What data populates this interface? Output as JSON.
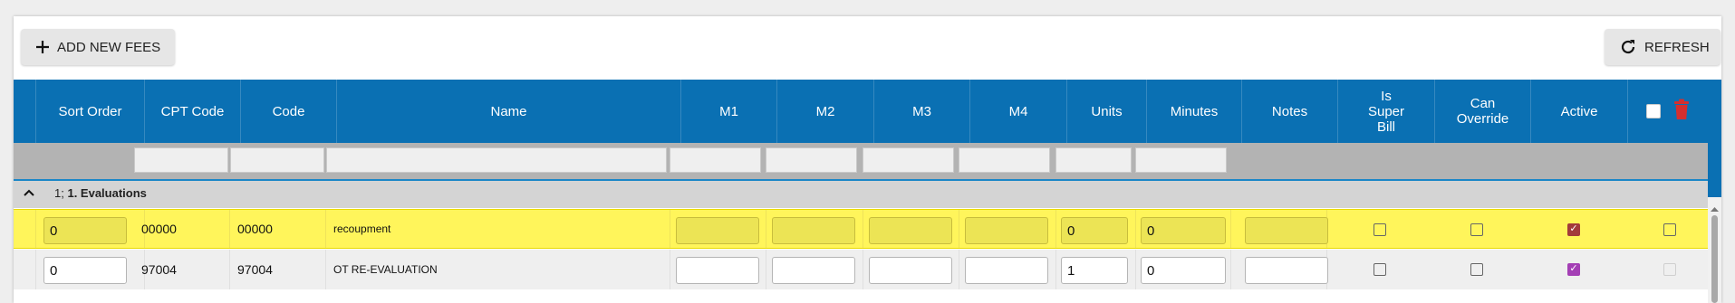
{
  "toolbar": {
    "add_label": "ADD NEW FEES",
    "refresh_label": "REFRESH"
  },
  "columns": {
    "sort_order": "Sort Order",
    "cpt_code": "CPT Code",
    "code": "Code",
    "name": "Name",
    "m1": "M1",
    "m2": "M2",
    "m3": "M3",
    "m4": "M4",
    "units": "Units",
    "minutes": "Minutes",
    "notes": "Notes",
    "is_super_bill": "Is Super Bill",
    "can_override": "Can Override",
    "active": "Active"
  },
  "group": {
    "prefix": "1;",
    "name": "1. Evaluations"
  },
  "rows": [
    {
      "sort_order": "0",
      "cpt_code": "00000",
      "code": "00000",
      "name": "recoupment",
      "m1": "",
      "m2": "",
      "m3": "",
      "m4": "",
      "units": "0",
      "minutes": "0",
      "notes": "",
      "is_super_bill": false,
      "can_override": false,
      "active": true,
      "selected": false
    },
    {
      "sort_order": "0",
      "cpt_code": "97004",
      "code": "97004",
      "name": "OT RE-EVALUATION",
      "m1": "",
      "m2": "",
      "m3": "",
      "m4": "",
      "units": "1",
      "minutes": "0",
      "notes": "",
      "is_super_bill": false,
      "can_override": false,
      "active": true,
      "selected": false
    }
  ],
  "colors": {
    "header_bg": "#0a70b3",
    "highlight_row": "#fff55b",
    "delete_icon": "#d32f2f",
    "active_check_hl": "#a33b3b",
    "active_check": "#a43fb5"
  },
  "icons": {
    "add": "plus-icon",
    "refresh": "refresh-icon",
    "delete": "trash-icon",
    "collapse": "chevron-up-icon"
  }
}
